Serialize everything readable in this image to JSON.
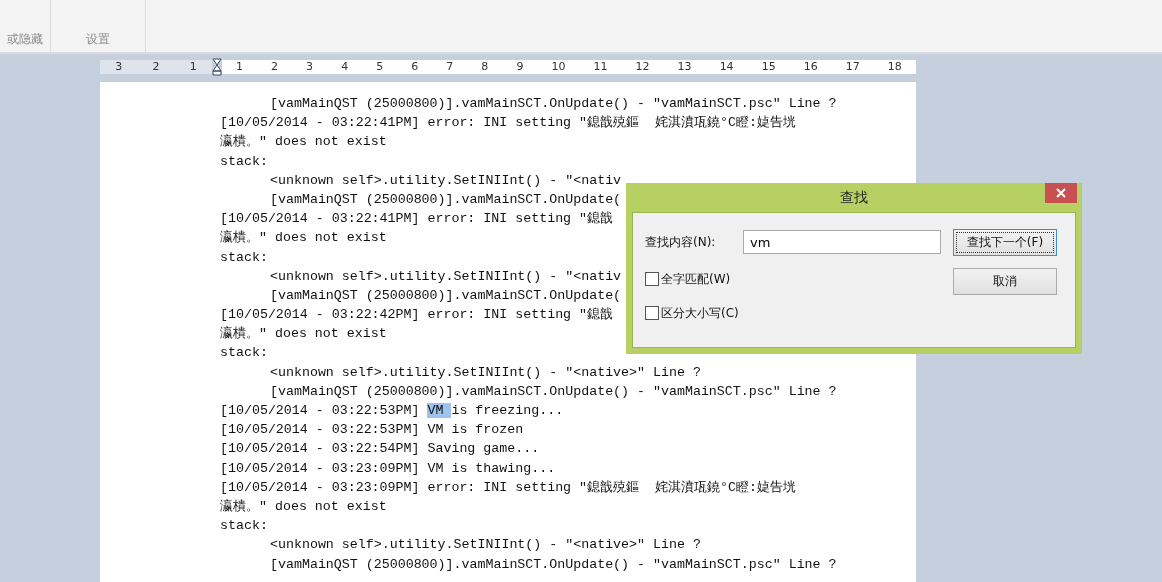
{
  "ribbon": {
    "groups": [
      "或隐藏",
      "设置"
    ]
  },
  "ruler": {
    "left_ticks": [
      "3",
      "2",
      "1"
    ],
    "right_ticks": [
      "1",
      "2",
      "3",
      "4",
      "5",
      "6",
      "7",
      "8",
      "9",
      "10",
      "11",
      "12",
      "13",
      "14",
      "15",
      "16",
      "17",
      "18"
    ]
  },
  "document": {
    "lines": [
      {
        "indent": true,
        "segments": [
          {
            "text": "[vamMainQST (25000800)].vamMainSCT.OnUpdate() - ″vamMainSCT.psc″ Line ?",
            "selected": false
          }
        ]
      },
      {
        "indent": false,
        "segments": [
          {
            "text": "[10/05/2014 - 03:22:41PM] error: INI setting ″鎴戠殑鏂  姹淇濆瓨鐃°C瞪:媫告垙",
            "selected": false
          }
        ]
      },
      {
        "indent": false,
        "segments": [
          {
            "text": "瀛樻。″ does not exist",
            "selected": false
          }
        ]
      },
      {
        "indent": false,
        "segments": [
          {
            "text": "stack:",
            "selected": false
          }
        ]
      },
      {
        "indent": true,
        "segments": [
          {
            "text": "<unknown self>.utility.SetINIInt() - ″<nativ",
            "selected": false
          }
        ]
      },
      {
        "indent": true,
        "segments": [
          {
            "text": "[vamMainQST (25000800)].vamMainSCT.OnUpdate(",
            "selected": false
          }
        ]
      },
      {
        "indent": false,
        "segments": [
          {
            "text": "[10/05/2014 - 03:22:41PM] error: INI setting ″鎴戠",
            "selected": false
          }
        ]
      },
      {
        "indent": false,
        "segments": [
          {
            "text": "瀛樻。″ does not exist",
            "selected": false
          }
        ]
      },
      {
        "indent": false,
        "segments": [
          {
            "text": "stack:",
            "selected": false
          }
        ]
      },
      {
        "indent": true,
        "segments": [
          {
            "text": "<unknown self>.utility.SetINIInt() - ″<nativ",
            "selected": false
          }
        ]
      },
      {
        "indent": true,
        "segments": [
          {
            "text": "[vamMainQST (25000800)].vamMainSCT.OnUpdate(",
            "selected": false
          }
        ]
      },
      {
        "indent": false,
        "segments": [
          {
            "text": "[10/05/2014 - 03:22:42PM] error: INI setting ″鎴戠",
            "selected": false
          }
        ]
      },
      {
        "indent": false,
        "segments": [
          {
            "text": "瀛樻。″ does not exist",
            "selected": false
          }
        ]
      },
      {
        "indent": false,
        "segments": [
          {
            "text": "stack:",
            "selected": false
          }
        ]
      },
      {
        "indent": true,
        "segments": [
          {
            "text": "<unknown self>.utility.SetINIInt() - ″<native>″ Line ?",
            "selected": false
          }
        ]
      },
      {
        "indent": true,
        "segments": [
          {
            "text": "[vamMainQST (25000800)].vamMainSCT.OnUpdate() - ″vamMainSCT.psc″ Line ?",
            "selected": false
          }
        ]
      },
      {
        "indent": false,
        "segments": [
          {
            "text": "[10/05/2014 - 03:22:53PM] ",
            "selected": false
          },
          {
            "text": "VM ",
            "selected": true
          },
          {
            "text": "is freezing...",
            "selected": false
          }
        ]
      },
      {
        "indent": false,
        "segments": [
          {
            "text": "[10/05/2014 - 03:22:53PM] VM is frozen",
            "selected": false
          }
        ]
      },
      {
        "indent": false,
        "segments": [
          {
            "text": "[10/05/2014 - 03:22:54PM] Saving game...",
            "selected": false
          }
        ]
      },
      {
        "indent": false,
        "segments": [
          {
            "text": "[10/05/2014 - 03:23:09PM] VM is thawing...",
            "selected": false
          }
        ]
      },
      {
        "indent": false,
        "segments": [
          {
            "text": "[10/05/2014 - 03:23:09PM] error: INI setting ″鎴戠殑鏂  姹淇濆瓨鐃°C瞪:媫告垙",
            "selected": false
          }
        ]
      },
      {
        "indent": false,
        "segments": [
          {
            "text": "瀛樻。″ does not exist",
            "selected": false
          }
        ]
      },
      {
        "indent": false,
        "segments": [
          {
            "text": "stack:",
            "selected": false
          }
        ]
      },
      {
        "indent": true,
        "segments": [
          {
            "text": "<unknown self>.utility.SetINIInt() - ″<native>″ Line ?",
            "selected": false
          }
        ]
      },
      {
        "indent": true,
        "segments": [
          {
            "text": "[vamMainQST (25000800)].vamMainSCT.OnUpdate() - ″vamMainSCT.psc″ Line ?",
            "selected": false
          }
        ]
      }
    ]
  },
  "find_dialog": {
    "title": "查找",
    "search_label": "查找内容(N):",
    "search_value": "vm",
    "options": [
      {
        "label": "全字匹配(W)",
        "checked": false
      },
      {
        "label": "区分大小写(C)",
        "checked": false
      }
    ],
    "buttons": [
      {
        "label": "查找下一个(F)",
        "selected": true
      },
      {
        "label": "取消",
        "selected": false
      }
    ]
  }
}
